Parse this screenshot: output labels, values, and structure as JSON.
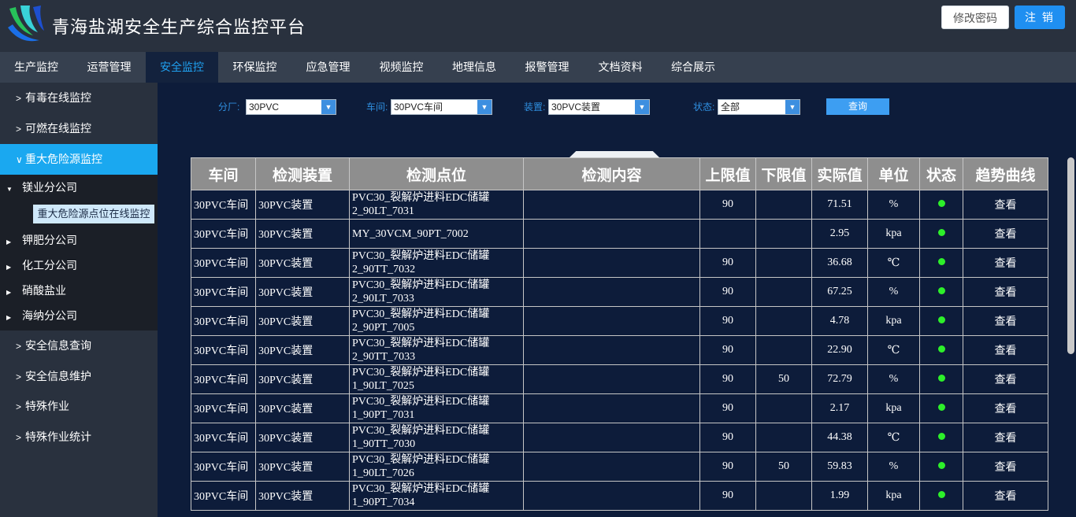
{
  "header": {
    "title": "青海盐湖安全生产综合监控平台",
    "change_password": "修改密码",
    "logout": "注 销"
  },
  "nav": [
    "生产监控",
    "运营管理",
    "安全监控",
    "环保监控",
    "应急管理",
    "视频监控",
    "地理信息",
    "报警管理",
    "文档资料",
    "综合展示"
  ],
  "nav_active": "安全监控",
  "sidebar": {
    "items_top": [
      "有毒在线监控",
      "可燃在线监控",
      "重大危险源监控"
    ],
    "subcompanies": [
      "镁业分公司",
      "钾肥分公司",
      "化工分公司",
      "硝酸盐业",
      "海纳分公司"
    ],
    "leaf": "重大危险源点位在线监控",
    "items_bottom": [
      "安全信息查询",
      "安全信息维护",
      "特殊作业",
      "特殊作业统计"
    ]
  },
  "filters": {
    "branch_label": "分厂:",
    "branch_value": "30PVC",
    "workshop_label": "车间:",
    "workshop_value": "30PVC车间",
    "device_label": "装置:",
    "device_value": "30PVC装置",
    "status_label": "状态:",
    "status_value": "全部",
    "query": "查询"
  },
  "table": {
    "headers": [
      "车间",
      "检测装置",
      "检测点位",
      "检测内容",
      "上限值",
      "下限值",
      "实际值",
      "单位",
      "状态",
      "趋势曲线"
    ],
    "rows": [
      {
        "workshop": "30PVC车间",
        "device": "30PVC装置",
        "point": "PVC30_裂解炉进料EDC储罐2_90LT_7031",
        "content": "",
        "upper": "90",
        "lower": "",
        "actual": "71.51",
        "unit": "%",
        "trend": "查看"
      },
      {
        "workshop": "30PVC车间",
        "device": "30PVC装置",
        "point": "MY_30VCM_90PT_7002",
        "content": "",
        "upper": "",
        "lower": "",
        "actual": "2.95",
        "unit": "kpa",
        "trend": "查看"
      },
      {
        "workshop": "30PVC车间",
        "device": "30PVC装置",
        "point": "PVC30_裂解炉进料EDC储罐2_90TT_7032",
        "content": "",
        "upper": "90",
        "lower": "",
        "actual": "36.68",
        "unit": "℃",
        "trend": "查看"
      },
      {
        "workshop": "30PVC车间",
        "device": "30PVC装置",
        "point": "PVC30_裂解炉进料EDC储罐2_90LT_7033",
        "content": "",
        "upper": "90",
        "lower": "",
        "actual": "67.25",
        "unit": "%",
        "trend": "查看"
      },
      {
        "workshop": "30PVC车间",
        "device": "30PVC装置",
        "point": "PVC30_裂解炉进料EDC储罐2_90PT_7005",
        "content": "",
        "upper": "90",
        "lower": "",
        "actual": "4.78",
        "unit": "kpa",
        "trend": "查看"
      },
      {
        "workshop": "30PVC车间",
        "device": "30PVC装置",
        "point": "PVC30_裂解炉进料EDC储罐2_90TT_7033",
        "content": "",
        "upper": "90",
        "lower": "",
        "actual": "22.90",
        "unit": "℃",
        "trend": "查看"
      },
      {
        "workshop": "30PVC车间",
        "device": "30PVC装置",
        "point": "PVC30_裂解炉进料EDC储罐1_90LT_7025",
        "content": "",
        "upper": "90",
        "lower": "50",
        "actual": "72.79",
        "unit": "%",
        "trend": "查看"
      },
      {
        "workshop": "30PVC车间",
        "device": "30PVC装置",
        "point": "PVC30_裂解炉进料EDC储罐1_90PT_7031",
        "content": "",
        "upper": "90",
        "lower": "",
        "actual": "2.17",
        "unit": "kpa",
        "trend": "查看"
      },
      {
        "workshop": "30PVC车间",
        "device": "30PVC装置",
        "point": "PVC30_裂解炉进料EDC储罐1_90TT_7030",
        "content": "",
        "upper": "90",
        "lower": "",
        "actual": "44.38",
        "unit": "℃",
        "trend": "查看"
      },
      {
        "workshop": "30PVC车间",
        "device": "30PVC装置",
        "point": "PVC30_裂解炉进料EDC储罐1_90LT_7026",
        "content": "",
        "upper": "90",
        "lower": "50",
        "actual": "59.83",
        "unit": "%",
        "trend": "查看"
      },
      {
        "workshop": "30PVC车间",
        "device": "30PVC装置",
        "point": "PVC30_裂解炉进料EDC储罐1_90PT_7034",
        "content": "",
        "upper": "90",
        "lower": "",
        "actual": "1.99",
        "unit": "kpa",
        "trend": "查看"
      }
    ]
  },
  "colors": {
    "status_ok": "#2df02a",
    "actual_value": "#f3ee2c",
    "link": "#29c4f2",
    "accent": "#1aa8f0"
  }
}
